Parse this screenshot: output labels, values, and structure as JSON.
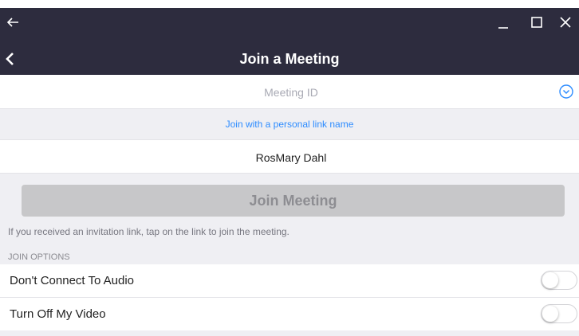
{
  "window": {
    "back_icon": "arrow-left-icon",
    "minimize_icon": "minimize-icon",
    "maximize_icon": "maximize-icon",
    "close_icon": "close-icon"
  },
  "header": {
    "title": "Join a Meeting",
    "back_icon": "chevron-left-icon"
  },
  "meeting_id": {
    "placeholder": "Meeting ID",
    "value": "",
    "dropdown_icon": "chevron-down-circle-icon"
  },
  "personal_link": {
    "label": "Join with a personal link name"
  },
  "name_field": {
    "value": "RosMary Dahl"
  },
  "join_button": {
    "label": "Join Meeting"
  },
  "hint": "If you received an invitation link, tap on the link to join the meeting.",
  "join_options": {
    "header": "JOIN OPTIONS",
    "items": [
      {
        "label": "Don't Connect To Audio",
        "on": false
      },
      {
        "label": "Turn Off My Video",
        "on": false
      }
    ]
  },
  "colors": {
    "header_bg": "#2d2c3e",
    "link": "#2d8cff",
    "button_disabled": "#c7c7c9"
  }
}
